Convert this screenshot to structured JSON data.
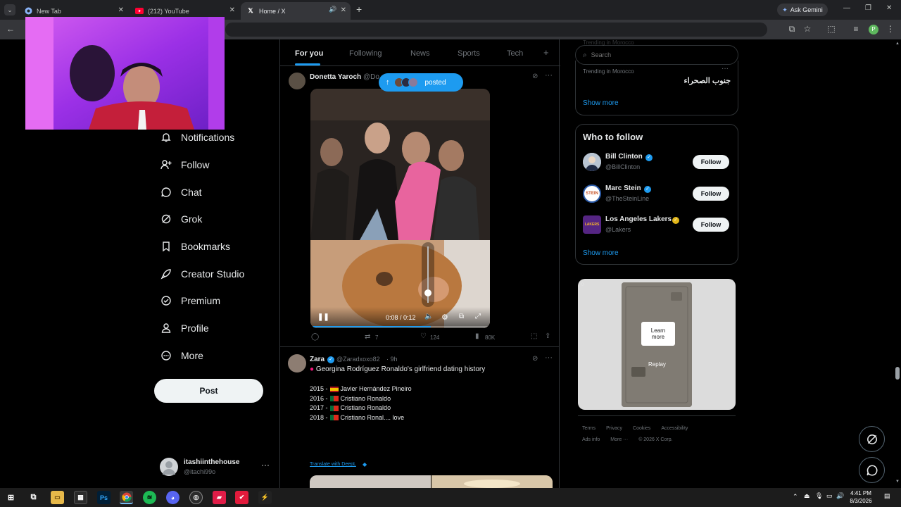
{
  "browser": {
    "tabs": [
      {
        "title": "New Tab"
      },
      {
        "title": "(212) YouTube"
      },
      {
        "title": "Home / X"
      }
    ],
    "ask_gemini": "Ask Gemini",
    "new_tab_symbol": "+"
  },
  "nav": {
    "items": [
      {
        "label": "Notifications"
      },
      {
        "label": "Follow"
      },
      {
        "label": "Chat"
      },
      {
        "label": "Grok"
      },
      {
        "label": "Bookmarks"
      },
      {
        "label": "Creator Studio"
      },
      {
        "label": "Premium"
      },
      {
        "label": "Profile"
      },
      {
        "label": "More"
      }
    ],
    "post_label": "Post",
    "account": {
      "name": "itashiinthehouse",
      "handle": "@itachi99o"
    }
  },
  "timeline": {
    "tabs": [
      "For you",
      "Following",
      "News",
      "Sports",
      "Tech"
    ],
    "add_tab": "+",
    "posted_pill": "posted",
    "post1": {
      "author": "Donetta Yaroch",
      "handle": "@Do",
      "video_time": "0:08 / 0:12",
      "video_progress": 0.67,
      "stats": {
        "reposts": "7",
        "likes": "124",
        "views": "80K"
      }
    },
    "post2": {
      "author": "Zara",
      "handle": "@Zaradxoxo82",
      "time": "· 9h",
      "headline": "Georgina Rodríguez Ronaldo's girlfriend dating history",
      "lines": [
        {
          "year": "2015 -",
          "name": "Javier Hernández Pineiro"
        },
        {
          "year": "2016 -",
          "name": "Cristiano Ronaldo"
        },
        {
          "year": "2017 -",
          "name": "Cristiano Ronaldo"
        },
        {
          "year": "2018 -",
          "name": "Cristiano Ronal.... love"
        }
      ],
      "translate": "Translate with DeepL"
    }
  },
  "sidebar": {
    "search_placeholder": "Search",
    "trending_top": "Trending in Morocco",
    "trending_label": "Trending in Morocco",
    "trending_topic": "جنوب الصحراء",
    "show_more": "Show more",
    "who_title": "Who to follow",
    "suggestions": [
      {
        "name": "Bill Clinton",
        "handle": "@BillClinton",
        "button": "Follow",
        "avatar": "BC"
      },
      {
        "name": "Marc Stein",
        "handle": "@TheSteinLine",
        "button": "Follow",
        "avatar": "STEIN"
      },
      {
        "name": "Los Angeles Lakers",
        "handle": "@Lakers",
        "button": "Follow",
        "avatar": "LAKERS"
      }
    ],
    "show_more_2": "Show more",
    "ad": {
      "learn_more": "Learn more",
      "replay": "Replay"
    },
    "footer": {
      "row1": [
        "Terms",
        "Privacy",
        "Cookies",
        "Accessibility"
      ],
      "row2": [
        "Ads info",
        "More ···",
        "© 2026 X Corp."
      ]
    }
  },
  "taskbar": {
    "time": "4:41 PM",
    "date": "8/3/2026"
  }
}
